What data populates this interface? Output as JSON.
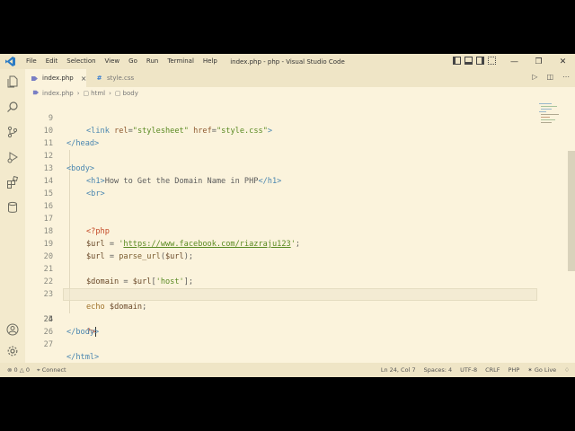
{
  "titlebar": {
    "menus": [
      "File",
      "Edit",
      "Selection",
      "View",
      "Go",
      "Run",
      "Terminal",
      "Help"
    ],
    "window_title": "index.php - php - Visual Studio Code"
  },
  "tabs": [
    {
      "label": "index.php",
      "icon": "php-file-icon",
      "active": true
    },
    {
      "label": "style.css",
      "icon": "css-file-icon",
      "active": false
    }
  ],
  "breadcrumb": [
    "index.php",
    "html",
    "body"
  ],
  "editor": {
    "lines": [
      {
        "n": "9",
        "code": "<link rel=\"stylesheet\" href=\"style.css\">"
      },
      {
        "n": "10",
        "code": "</head>"
      },
      {
        "n": "11",
        "code": ""
      },
      {
        "n": "12",
        "code": "<body>"
      },
      {
        "n": "13",
        "code": "<h1>How to Get the Domain Name in PHP</h1>"
      },
      {
        "n": "14",
        "code": "<br>"
      },
      {
        "n": "15",
        "code": ""
      },
      {
        "n": "16",
        "code": ""
      },
      {
        "n": "17",
        "code": "<?php"
      },
      {
        "n": "18",
        "code": "$url = 'https://www.facebook.com/riazraju123';"
      },
      {
        "n": "19",
        "code": "$url = parse_url($url);"
      },
      {
        "n": "20",
        "code": ""
      },
      {
        "n": "21",
        "code": "$domain = $url['host'];"
      },
      {
        "n": "22",
        "code": ""
      },
      {
        "n": "23",
        "code": "echo $domain;"
      },
      {
        "n": "24",
        "code": "?>"
      },
      {
        "n": "25",
        "code": "</body>"
      },
      {
        "n": "26",
        "code": ""
      },
      {
        "n": "27",
        "code": "</html>"
      }
    ]
  },
  "statusbar": {
    "errors": "0",
    "warnings": "0",
    "connect": "Connect",
    "position": "Ln 24, Col 7",
    "spaces": "Spaces: 4",
    "encoding": "UTF-8",
    "eol": "CRLF",
    "language": "PHP",
    "golive": "Go Live"
  },
  "colors": {
    "background": "#fbf3dc",
    "chrome": "#efe5c6",
    "tag": "#4a86b0",
    "string": "#5a8a22",
    "php_tag": "#c44b29"
  }
}
